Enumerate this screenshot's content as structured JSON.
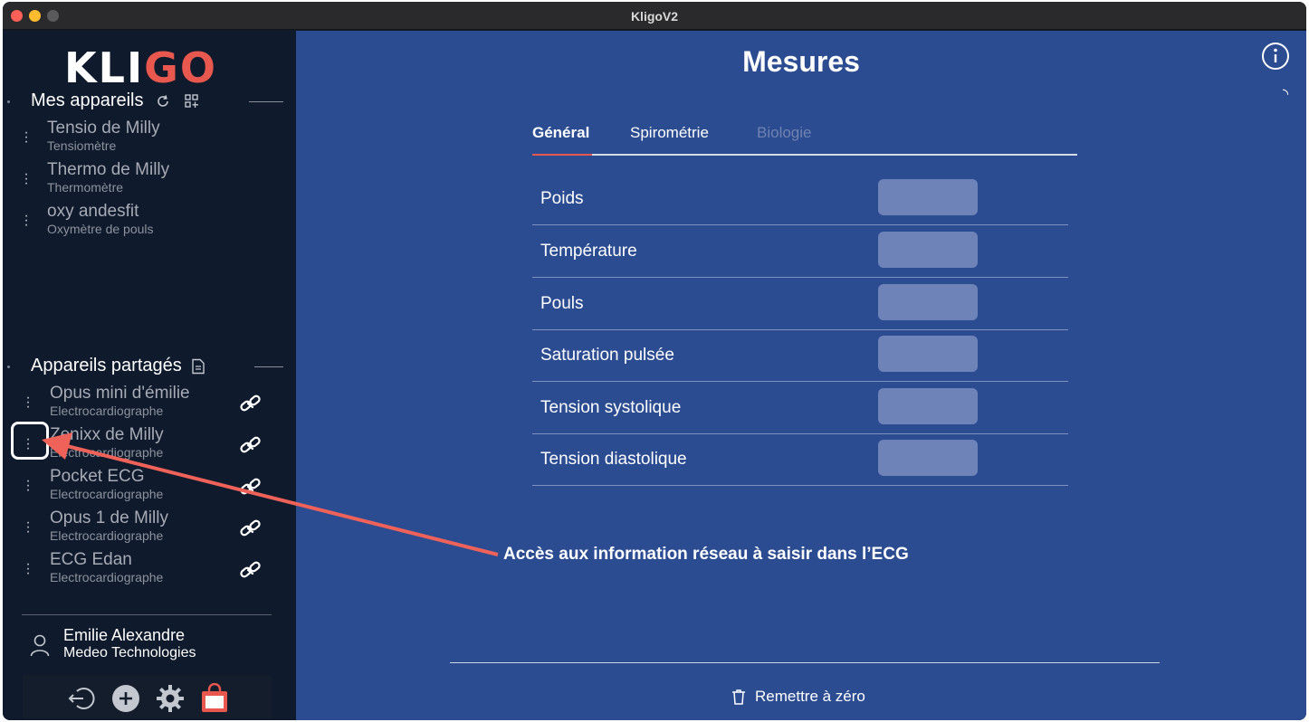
{
  "window": {
    "title": "KligoV2"
  },
  "logo": {
    "text_main": "KLI",
    "text_accent": "GO"
  },
  "my_devices": {
    "title": "Mes appareils",
    "icons": [
      "refresh-icon",
      "add-grid-icon"
    ],
    "items": [
      {
        "name": "Tensio de Milly",
        "type": "Tensiomètre"
      },
      {
        "name": "Thermo de Milly",
        "type": "Thermomètre"
      },
      {
        "name": "oxy andesfit",
        "type": "Oxymètre de pouls"
      }
    ]
  },
  "shared_devices": {
    "title": "Appareils partagés",
    "icons": [
      "document-icon"
    ],
    "items": [
      {
        "name": "Opus mini d'émilie",
        "type": "Electrocardiographe"
      },
      {
        "name": "Zenixx de Milly",
        "type": "Electrocardiographe"
      },
      {
        "name": "Pocket ECG",
        "type": "Electrocardiographe"
      },
      {
        "name": "Opus 1 de Milly",
        "type": "Electrocardiographe"
      },
      {
        "name": "ECG Edan",
        "type": "Electrocardiographe"
      }
    ]
  },
  "user": {
    "name": "Emilie Alexandre",
    "organization": "Medeo Technologies"
  },
  "toolbar": [
    "logout-icon",
    "add-icon",
    "settings-icon",
    "shop-bag-icon"
  ],
  "main": {
    "title": "Mesures",
    "tabs": [
      {
        "label": "Général",
        "state": "active"
      },
      {
        "label": "Spirométrie",
        "state": "normal"
      },
      {
        "label": "Biologie",
        "state": "disabled"
      }
    ],
    "measures": [
      {
        "label": "Poids",
        "value": ""
      },
      {
        "label": "Température",
        "value": ""
      },
      {
        "label": "Pouls",
        "value": ""
      },
      {
        "label": "Saturation pulsée",
        "value": ""
      },
      {
        "label": "Tension systolique",
        "value": ""
      },
      {
        "label": "Tension diastolique",
        "value": ""
      }
    ],
    "reset_label": "Remettre à zéro"
  },
  "annotation": {
    "text": "Accès aux information réseau à saisir dans l’ECG"
  },
  "colors": {
    "sidebar_bg": "#0f1a2c",
    "main_bg": "#2c4c92",
    "accent": "#e8584f",
    "input_bg": "#6e84b8"
  }
}
